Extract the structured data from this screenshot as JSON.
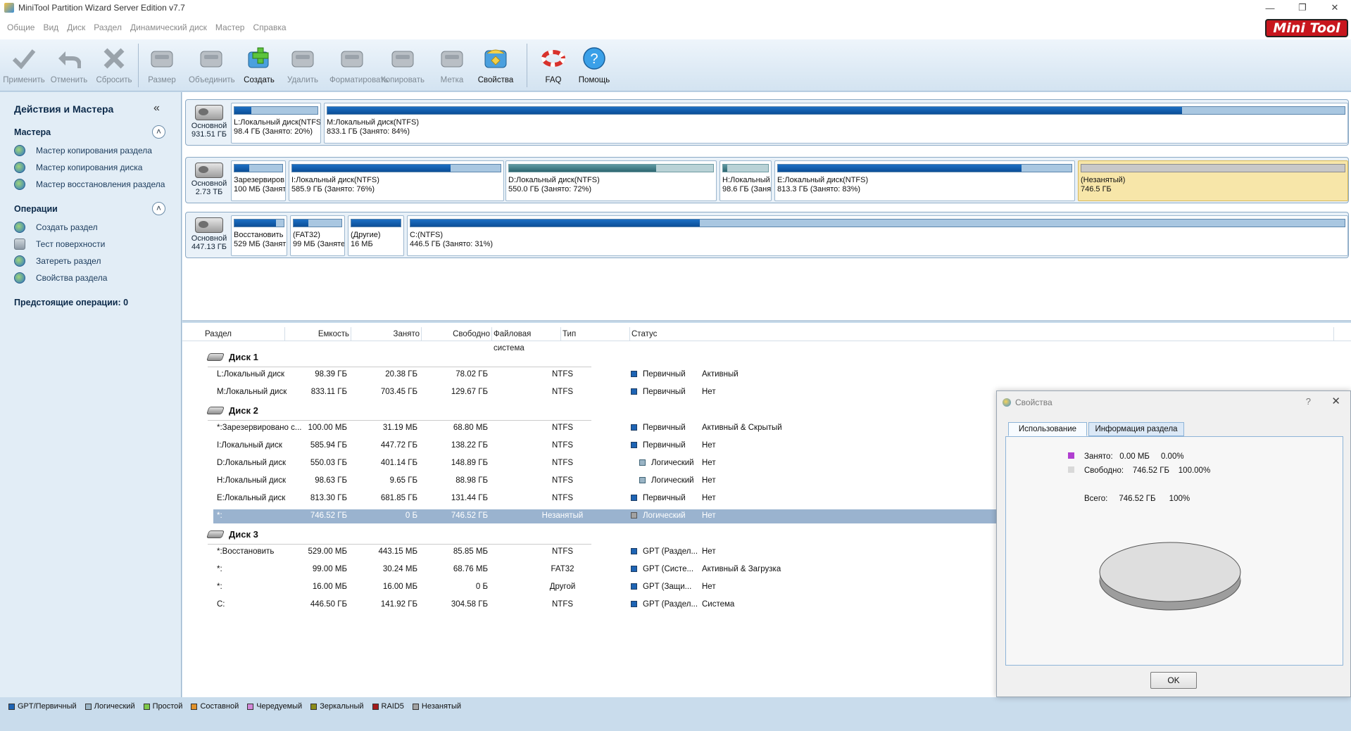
{
  "window": {
    "title": "MiniTool Partition Wizard Server Edition v7.7"
  },
  "menu": [
    "Общие",
    "Вид",
    "Диск",
    "Раздел",
    "Динамический диск",
    "Мастер",
    "Справка"
  ],
  "logo": {
    "part1": "Mini",
    "part2": "Tool"
  },
  "toolbar": [
    {
      "label": "Применить",
      "icon": "check-icon",
      "enabled": false
    },
    {
      "label": "Отменить",
      "icon": "undo-icon",
      "enabled": false
    },
    {
      "label": "Сбросить",
      "icon": "cross-icon",
      "enabled": false
    },
    {
      "label": "Размер",
      "icon": "resize-disk-icon",
      "enabled": false
    },
    {
      "label": "Объединить",
      "icon": "merge-disk-icon",
      "enabled": false
    },
    {
      "label": "Создать",
      "icon": "create-partition-icon",
      "enabled": true
    },
    {
      "label": "Удалить",
      "icon": "delete-partition-icon",
      "enabled": false
    },
    {
      "label": "Форматировать",
      "icon": "format-disk-icon",
      "enabled": false
    },
    {
      "label": "Копировать",
      "icon": "copy-disk-icon",
      "enabled": false
    },
    {
      "label": "Метка",
      "icon": "label-disk-icon",
      "enabled": false
    },
    {
      "label": "Свойства",
      "icon": "properties-icon",
      "enabled": true
    },
    {
      "label": "FAQ",
      "icon": "lifebuoy-icon",
      "enabled": true
    },
    {
      "label": "Помощь",
      "icon": "help-icon",
      "enabled": true
    }
  ],
  "sidebar": {
    "title": "Действия и Мастера",
    "wizards_title": "Мастера",
    "wizards": [
      "Мастер копирования раздела",
      "Мастер копирования диска",
      "Мастер восстановления раздела"
    ],
    "ops_title": "Операции",
    "ops": [
      "Создать раздел",
      "Тест поверхности",
      "Затереть раздел",
      "Свойства раздела"
    ],
    "pending": "Предстоящие операции: 0"
  },
  "diskmap": [
    {
      "type": "Основной",
      "size": "931.51 ГБ",
      "parts": [
        {
          "l1": "L:Локальный диск(NTFS)",
          "l2": "98.4 ГБ (Занято: 20%)",
          "used": 20,
          "kind": "primary"
        },
        {
          "l1": "M:Локальный диск(NTFS)",
          "l2": "833.1 ГБ (Занято: 84%)",
          "used": 84,
          "kind": "primary"
        }
      ]
    },
    {
      "type": "Основной",
      "size": "2.73 ТБ",
      "parts": [
        {
          "l1": "Зарезервиров",
          "l2": "100 МБ (Заняти",
          "used": 31,
          "kind": "primary"
        },
        {
          "l1": "I:Локальный диск(NTFS)",
          "l2": "585.9 ГБ (Занято: 76%)",
          "used": 76,
          "kind": "primary"
        },
        {
          "l1": "D:Локальный диск(NTFS)",
          "l2": "550.0 ГБ (Занято: 72%)",
          "used": 72,
          "kind": "logical"
        },
        {
          "l1": "H:Локальный",
          "l2": "98.6 ГБ (Заня",
          "used": 10,
          "kind": "logical"
        },
        {
          "l1": "E:Локальный диск(NTFS)",
          "l2": "813.3 ГБ (Занято: 83%)",
          "used": 83,
          "kind": "primary"
        },
        {
          "l1": "(Незанятый)",
          "l2": "746.5 ГБ",
          "used": 0,
          "kind": "unalloc"
        }
      ]
    },
    {
      "type": "Основной",
      "size": "447.13 ГБ",
      "parts": [
        {
          "l1": "Восстановить",
          "l2": "529 МБ (Заняти",
          "used": 84,
          "kind": "primary"
        },
        {
          "l1": "(FAT32)",
          "l2": "99 МБ (Заняте",
          "used": 31,
          "kind": "primary"
        },
        {
          "l1": "(Другие)",
          "l2": "16 МБ",
          "used": 100,
          "kind": "primary"
        },
        {
          "l1": "C:(NTFS)",
          "l2": "446.5 ГБ (Занято: 31%)",
          "used": 31,
          "kind": "primary"
        }
      ]
    }
  ],
  "list": {
    "headers": [
      "Раздел",
      "Емкость",
      "Занято",
      "Свободно",
      "Файловая система",
      "Тип",
      "Статус"
    ],
    "disks": [
      {
        "name": "Диск 1",
        "rows": [
          [
            "L:Локальный диск",
            "98.39 ГБ",
            "20.38 ГБ",
            "78.02 ГБ",
            "NTFS",
            "Первичный",
            "Активный"
          ],
          [
            "M:Локальный диск",
            "833.11 ГБ",
            "703.45 ГБ",
            "129.67 ГБ",
            "NTFS",
            "Первичный",
            "Нет"
          ]
        ]
      },
      {
        "name": "Диск 2",
        "rows": [
          [
            "*:Зарезервировано с...",
            "100.00 МБ",
            "31.19 МБ",
            "68.80 МБ",
            "NTFS",
            "Первичный",
            "Активный & Скрытый"
          ],
          [
            "I:Локальный диск",
            "585.94 ГБ",
            "447.72 ГБ",
            "138.22 ГБ",
            "NTFS",
            "Первичный",
            "Нет"
          ],
          [
            "D:Локальный диск",
            "550.03 ГБ",
            "401.14 ГБ",
            "148.89 ГБ",
            "NTFS",
            "Логический",
            "Нет"
          ],
          [
            "H:Локальный диск",
            "98.63 ГБ",
            "9.65 ГБ",
            "88.98 ГБ",
            "NTFS",
            "Логический",
            "Нет"
          ],
          [
            "E:Локальный диск",
            "813.30 ГБ",
            "681.85 ГБ",
            "131.44 ГБ",
            "NTFS",
            "Первичный",
            "Нет"
          ],
          [
            "*:",
            "746.52 ГБ",
            "0 Б",
            "746.52 ГБ",
            "Незанятый",
            "Логический",
            "Нет"
          ]
        ]
      },
      {
        "name": "Диск 3",
        "rows": [
          [
            "*:Восстановить",
            "529.00 МБ",
            "443.15 МБ",
            "85.85 МБ",
            "NTFS",
            "GPT (Раздел...",
            "Нет"
          ],
          [
            "*:",
            "99.00 МБ",
            "30.24 МБ",
            "68.76 МБ",
            "FAT32",
            "GPT (Систе...",
            "Активный & Загрузка"
          ],
          [
            "*:",
            "16.00 МБ",
            "16.00 МБ",
            "0 Б",
            "Другой",
            "GPT (Защи...",
            "Нет"
          ],
          [
            "C:",
            "446.50 ГБ",
            "141.92 ГБ",
            "304.58 ГБ",
            "NTFS",
            "GPT (Раздел...",
            "Система"
          ]
        ]
      }
    ]
  },
  "legend": [
    {
      "label": "GPT/Первичный",
      "color": "#1e64b4"
    },
    {
      "label": "Логический",
      "color": "#9ab4c5"
    },
    {
      "label": "Простой",
      "color": "#7fc94a"
    },
    {
      "label": "Составной",
      "color": "#e0912a"
    },
    {
      "label": "Чередуемый",
      "color": "#d287d8"
    },
    {
      "label": "Зеркальный",
      "color": "#8c8c1a"
    },
    {
      "label": "RAID5",
      "color": "#a31b1b"
    },
    {
      "label": "Незанятый",
      "color": "#a2a2a2"
    }
  ],
  "dialog": {
    "title": "Свойства",
    "help": "?",
    "close": "✕",
    "tab1": "Использование",
    "tab2": "Информация раздела",
    "used_label": "Занято:",
    "used_value": "0.00 МБ",
    "used_pct": "0.00%",
    "free_label": "Свободно:",
    "free_value": "746.52 ГБ",
    "free_pct": "100.00%",
    "total_label": "Всего:",
    "total_value": "746.52 ГБ",
    "total_pct": "100%",
    "used_color": "#b03fd0",
    "free_color": "#d9d9d9",
    "ok": "OK"
  }
}
